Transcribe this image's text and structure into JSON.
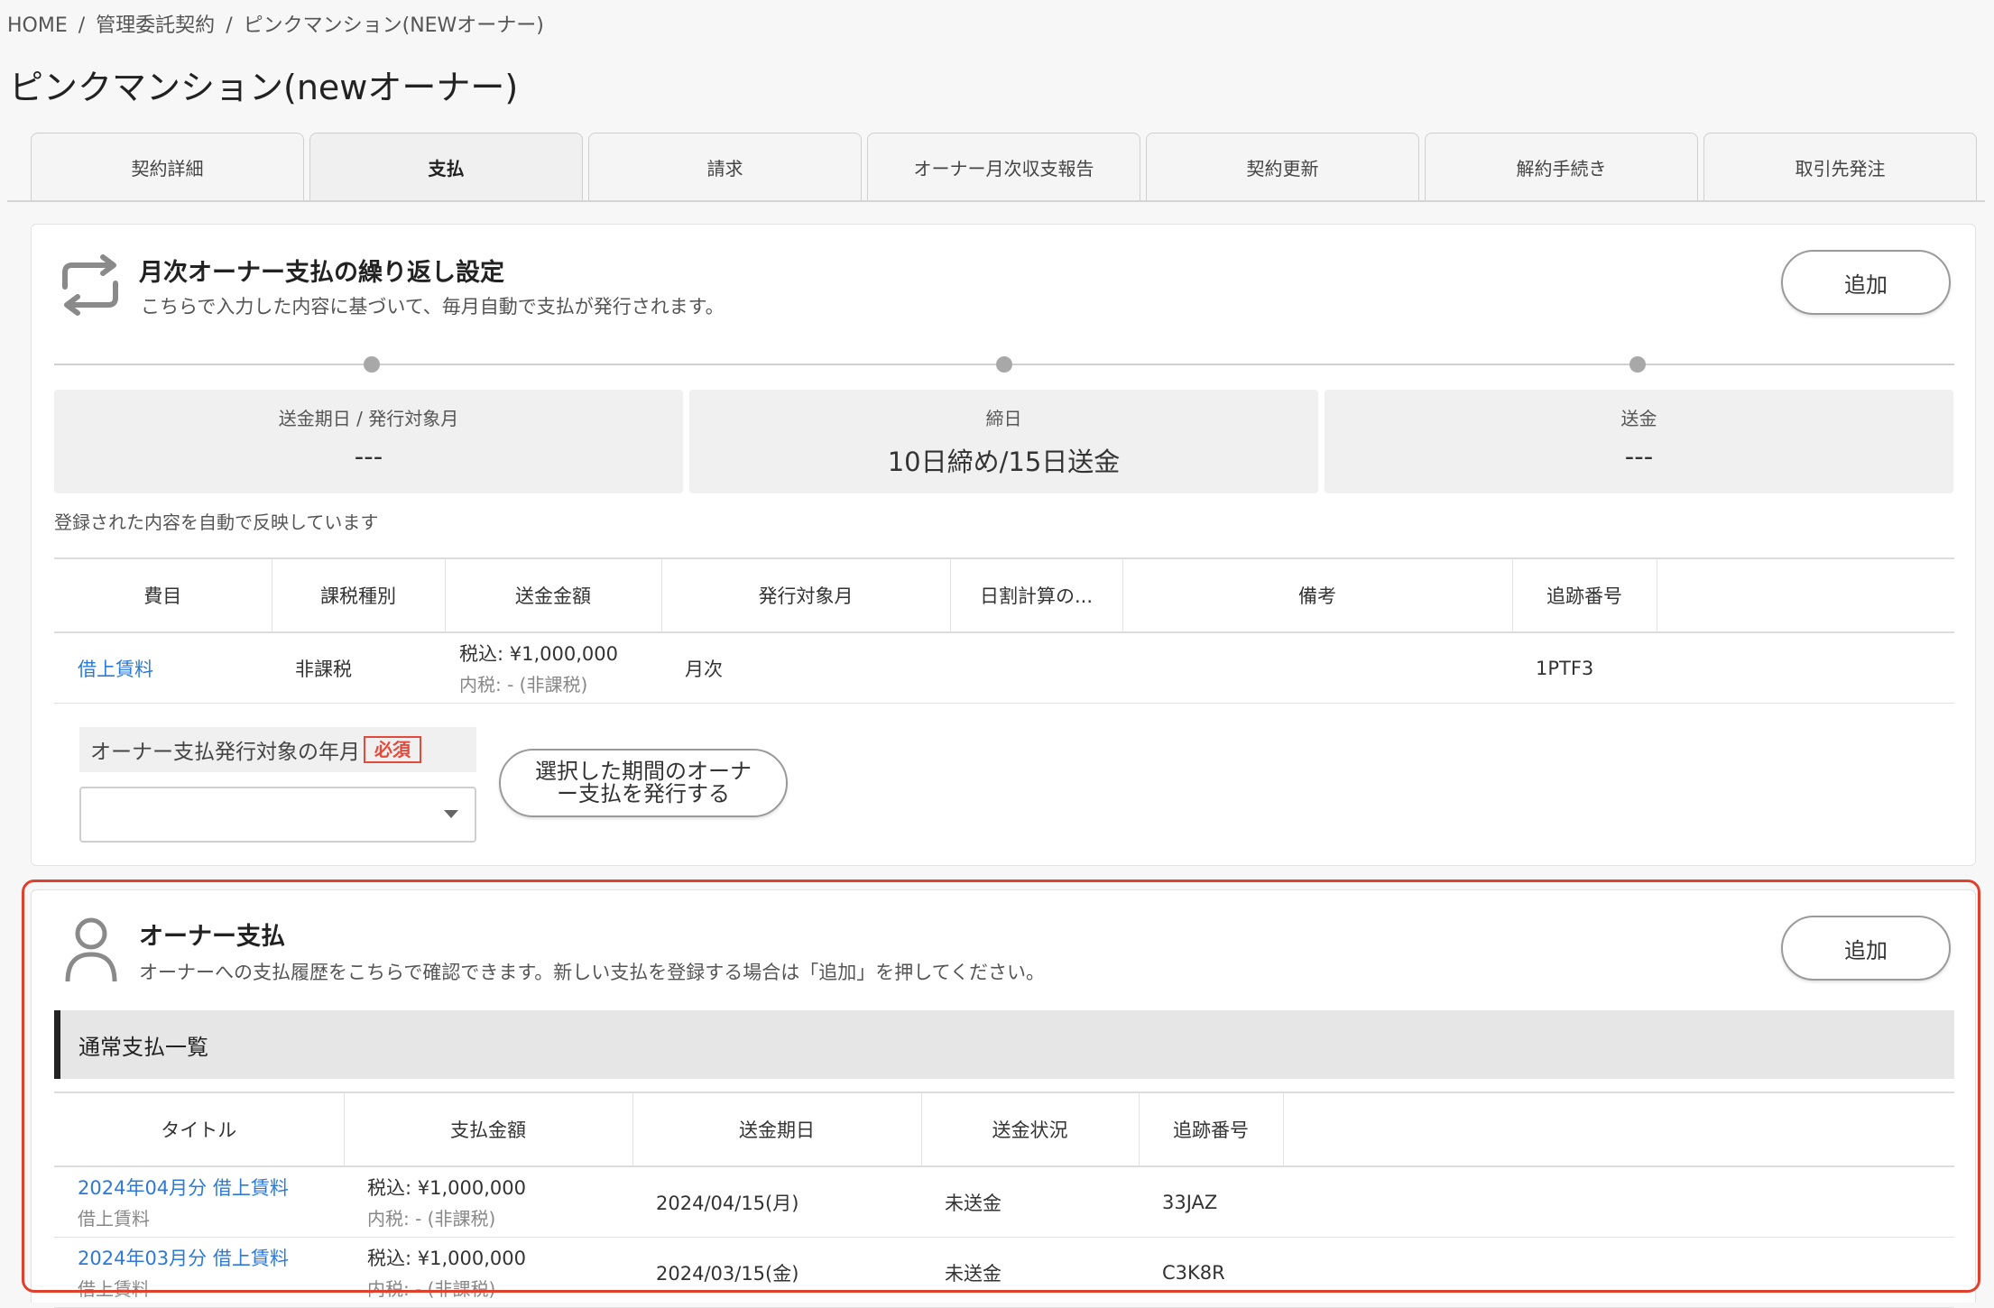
{
  "breadcrumb": {
    "home": "HOME",
    "sep1": "/",
    "level1": "管理委託契約",
    "sep2": "/",
    "level2": "ピンクマンション(NEWオーナー)"
  },
  "page_title": "ピンクマンション(newオーナー)",
  "tabs": [
    {
      "label": "契約詳細"
    },
    {
      "label": "支払"
    },
    {
      "label": "請求"
    },
    {
      "label": "オーナー月次収支報告"
    },
    {
      "label": "契約更新"
    },
    {
      "label": "解約手続き"
    },
    {
      "label": "取引先発注"
    }
  ],
  "active_tab": "支払",
  "recurring": {
    "title": "月次オーナー支払の繰り返し設定",
    "description": "こちらで入力した内容に基づいて、毎月自動で支払が発行されます。",
    "add_button": "追加",
    "summary": [
      {
        "label": "送金期日 / 発行対象月",
        "value": "---"
      },
      {
        "label": "締日",
        "value": "10日締め/15日送金"
      },
      {
        "label": "送金",
        "value": "---"
      }
    ],
    "note": "登録された内容を自動で反映しています",
    "table": {
      "headers": [
        "費目",
        "課税種別",
        "送金金額",
        "発行対象月",
        "日割計算の...",
        "備考",
        "追跡番号",
        ""
      ],
      "rows": [
        {
          "item": "借上賃料",
          "tax_type": "非課税",
          "amount": "税込: ¥1,000,000",
          "amount_tax": "内税: - (非課税)",
          "target_month": "月次",
          "prorate": "",
          "remarks": "",
          "tracking": "1PTF3"
        }
      ]
    },
    "form": {
      "label": "オーナー支払発行対象の年月",
      "required": "必須",
      "select_value": "",
      "issue_button_line1": "選択した期間のオーナ",
      "issue_button_line2": "ー支払を発行する"
    }
  },
  "owner_payment": {
    "title": "オーナー支払",
    "description": "オーナーへの支払履歴をこちらで確認できます。新しい支払を登録する場合は「追加」を押してください。",
    "add_button": "追加",
    "section_title": "通常支払一覧",
    "table": {
      "headers": [
        "タイトル",
        "支払金額",
        "送金期日",
        "送金状況",
        "追跡番号",
        ""
      ],
      "rows": [
        {
          "title": "2024年04月分 借上賃料",
          "subtitle": "借上賃料",
          "amount": "税込: ¥1,000,000",
          "amount_tax": "内税: - (非課税)",
          "due_date": "2024/04/15(月)",
          "status": "未送金",
          "tracking": "33JAZ"
        },
        {
          "title": "2024年03月分 借上賃料",
          "subtitle": "借上賃料",
          "amount": "税込: ¥1,000,000",
          "amount_tax": "内税: - (非課税)",
          "due_date": "2024/03/15(金)",
          "status": "未送金",
          "tracking": "C3K8R"
        }
      ]
    }
  },
  "colors": {
    "link": "#2d7ad6",
    "required": "#e24a3b",
    "highlight": "#e0412f"
  },
  "icons": {
    "recurring": "repeat-icon",
    "owner": "person-icon",
    "select": "chevron-down-icon"
  }
}
